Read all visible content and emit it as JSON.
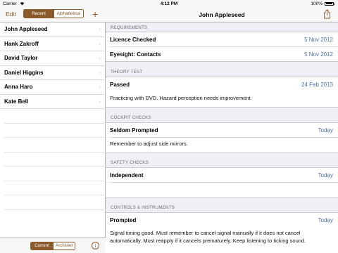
{
  "status_bar": {
    "carrier": "Carrier",
    "time": "4:12 PM",
    "battery": "100%"
  },
  "master": {
    "edit_label": "Edit",
    "sort_segments": [
      {
        "label": "Recent",
        "selected": true
      },
      {
        "label": "Alphabetical",
        "selected": false
      }
    ],
    "add_label": "+",
    "students": [
      {
        "name": "John Appleseed"
      },
      {
        "name": "Hank Zakroff"
      },
      {
        "name": "David Taylor"
      },
      {
        "name": "Daniel Higgins"
      },
      {
        "name": "Anna Haro"
      },
      {
        "name": "Kate Bell"
      }
    ],
    "filter_segments": [
      {
        "label": "Current",
        "selected": true
      },
      {
        "label": "Archived",
        "selected": false
      }
    ],
    "info_label": "i",
    "chevron": "›"
  },
  "detail": {
    "title": "John Appleseed",
    "sections": {
      "requirements": {
        "header": "REQUIREMENTS",
        "rows": [
          {
            "label": "Licence Checked",
            "value": "5 Nov 2012"
          },
          {
            "label": "Eyesight: Contacts",
            "value": "5 Nov 2012"
          }
        ]
      },
      "theory_test": {
        "header": "THEORY TEST",
        "label": "Passed",
        "value": "24 Feb 2013",
        "note": "Practicing with DVD. Hazard perception needs improvement."
      },
      "cockpit_checks": {
        "header": "COCKPIT CHECKS",
        "label": "Seldom Prompted",
        "value": "Today",
        "note": "Remember to adjust side mirrors."
      },
      "safety_checks": {
        "header": "SAFETY CHECKS",
        "label": "Independent",
        "value": "Today",
        "note": ""
      },
      "controls_instruments": {
        "header": "CONTROLS & INSTRUMENTS",
        "label": "Prompted",
        "value": "Today",
        "note": "Signal timing good. Must remember to cancel signal manually if it does not cancel automatically. Must reapply if it cancels prematurely. Keep listening to ticking sound."
      }
    }
  },
  "colors": {
    "accent": "#8b5a2b",
    "value_blue": "#4a6fa5",
    "group_bg": "#efeff4"
  }
}
